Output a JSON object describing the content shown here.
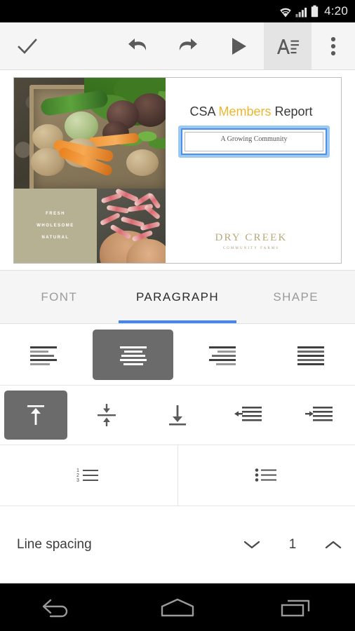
{
  "status_bar": {
    "time": "4:20",
    "icons": [
      "wifi-icon",
      "cellular-signal-icon",
      "battery-icon"
    ]
  },
  "toolbar": {
    "accept_label": "check-icon",
    "undo_label": "undo-icon",
    "redo_label": "redo-icon",
    "present_label": "present-play-icon",
    "format_label": "text-format-icon",
    "overflow_label": "overflow-menu-icon",
    "active_button": "text-format-icon"
  },
  "slide": {
    "title_part1": "CSA ",
    "title_accent": "Members",
    "title_part2": " Report",
    "subtitle": "A Growing Community",
    "tagline": [
      "FRESH",
      "WHOLESOME",
      "NATURAL"
    ],
    "logo_main": "DRY CREEK",
    "logo_sub": "COMMUNITY FARMS",
    "selection_color": "#4a90e8",
    "selection_glow": "#9cc8f4",
    "accent_color": "#efb52c",
    "tagline_bg": "#b5b192",
    "logo_color": "#b7a878"
  },
  "tabs": {
    "items": [
      {
        "label": "FONT",
        "active": false
      },
      {
        "label": "PARAGRAPH",
        "active": true
      },
      {
        "label": "SHAPE",
        "active": false
      }
    ],
    "indicator_color": "#4285f4"
  },
  "paragraph": {
    "alignment": {
      "options": [
        {
          "name": "align-left-icon",
          "label": "Align left",
          "selected": false
        },
        {
          "name": "align-center-icon",
          "label": "Align center",
          "selected": true
        },
        {
          "name": "align-right-icon",
          "label": "Align right",
          "selected": false
        },
        {
          "name": "align-justify-icon",
          "label": "Justify",
          "selected": false
        }
      ],
      "selected_index": 1
    },
    "vertical_alignment": {
      "options": [
        {
          "name": "valign-top-icon",
          "label": "Align top",
          "selected": true
        },
        {
          "name": "valign-middle-icon",
          "label": "Align middle",
          "selected": false
        },
        {
          "name": "valign-bottom-icon",
          "label": "Align bottom",
          "selected": false
        },
        {
          "name": "decrease-indent-icon",
          "label": "Decrease indent",
          "selected": false
        },
        {
          "name": "increase-indent-icon",
          "label": "Increase indent",
          "selected": false
        }
      ],
      "selected_index": 0
    },
    "lists": {
      "options": [
        {
          "name": "numbered-list-icon",
          "label": "Numbered list",
          "markers": [
            "1",
            "2",
            "3"
          ]
        },
        {
          "name": "bulleted-list-icon",
          "label": "Bulleted list",
          "markers": [
            "•",
            "•",
            "•"
          ]
        }
      ]
    },
    "line_spacing": {
      "label": "Line spacing",
      "value": "1",
      "decrease_icon": "chevron-down-icon",
      "increase_icon": "chevron-up-icon"
    }
  },
  "nav_bar": {
    "items": [
      {
        "name": "back-button",
        "label": "Back"
      },
      {
        "name": "home-button",
        "label": "Home"
      },
      {
        "name": "recents-button",
        "label": "Recents"
      }
    ]
  }
}
